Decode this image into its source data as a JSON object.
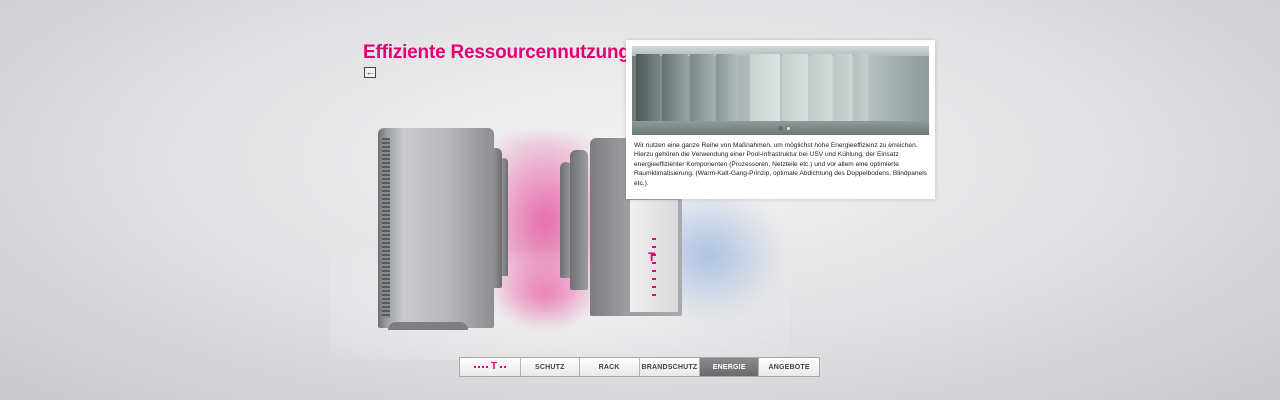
{
  "page": {
    "title": "Effiziente Ressourcennutzung",
    "back_icon": "arrow-left-icon",
    "brand_color": "#e20074"
  },
  "info_panel": {
    "text": "Wir nutzen eine ganze Reihe von Maßnahmen, um möglichst hohe Energieeffizienz zu erreichen. Hierzu gehören die Verwendung einer Pool-Infrastruktur bei USV und Kühlung, der Einsatz energieeffizienter Komponenten (Prozessoren, Netzteile etc.) und vor allem eine optimierte Raumklimatisierung. (Warm-Kalt-Gang-Prinzip, optimale Abdichtung des Doppelbodens, Blindpanels etc.).",
    "gallery": {
      "count": 2,
      "active_index": 0
    }
  },
  "nav": {
    "logo_icon": "telekom-logo-icon",
    "items": [
      {
        "label": "SCHUTZ",
        "active": false
      },
      {
        "label": "RACK",
        "active": false
      },
      {
        "label": "BRANDSCHUTZ",
        "active": false
      },
      {
        "label": "ENERGIE",
        "active": true
      },
      {
        "label": "ANGEBOTE",
        "active": false
      }
    ]
  }
}
